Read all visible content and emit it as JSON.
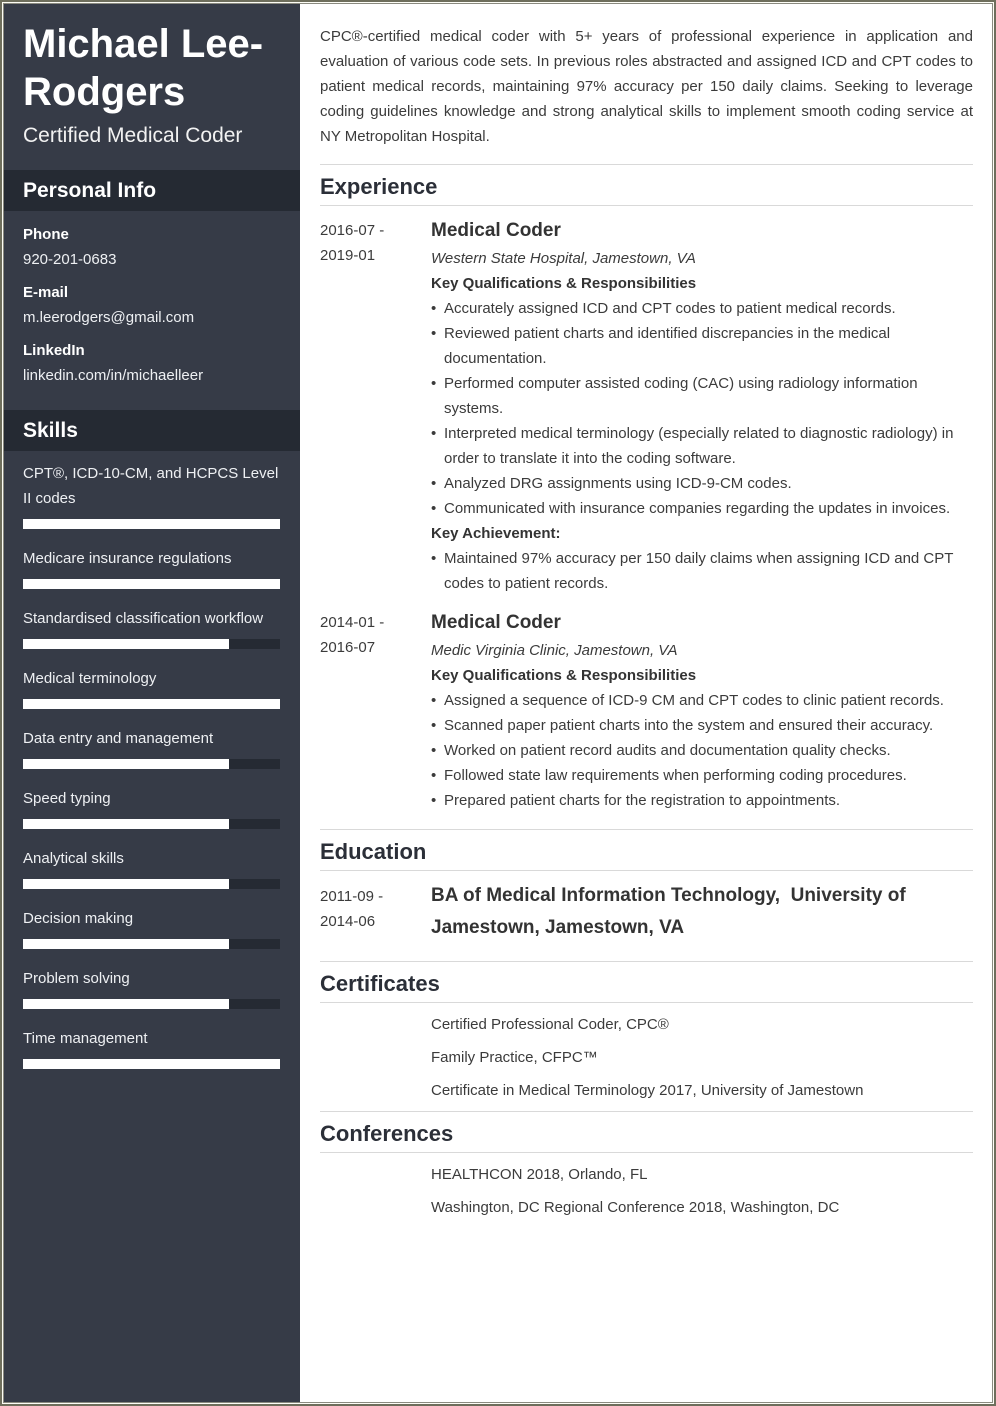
{
  "profile": {
    "name": "Michael Lee-Rodgers",
    "title": "Certified Medical Coder"
  },
  "personal_info": {
    "heading": "Personal Info",
    "fields": [
      {
        "label": "Phone",
        "value": "920-201-0683"
      },
      {
        "label": "E-mail",
        "value": "m.leerodgers@gmail.com"
      },
      {
        "label": "LinkedIn",
        "value": "linkedin.com/in/michaelleer"
      }
    ]
  },
  "skills": {
    "heading": "Skills",
    "items": [
      {
        "name": "CPT®, ICD-10-CM, and HCPCS Level II codes",
        "level": 1.0
      },
      {
        "name": "Medicare insurance regulations",
        "level": 1.0
      },
      {
        "name": "Standardised classification workflow",
        "level": 0.8
      },
      {
        "name": "Medical terminology",
        "level": 1.0
      },
      {
        "name": "Data entry and management",
        "level": 0.8
      },
      {
        "name": "Speed typing",
        "level": 0.8
      },
      {
        "name": "Analytical skills",
        "level": 0.8
      },
      {
        "name": "Decision making",
        "level": 0.8
      },
      {
        "name": "Problem solving",
        "level": 0.8
      },
      {
        "name": "Time management",
        "level": 1.0
      }
    ]
  },
  "summary": "CPC®-certified medical coder with 5+ years of professional experience in application and evaluation of various code sets. In previous roles abstracted and assigned ICD and CPT codes to patient medical records, maintaining 97% accuracy per 150 daily claims. Seeking to leverage coding guidelines knowledge and strong analytical skills to implement smooth coding service at NY Metropolitan Hospital.",
  "experience": {
    "heading": "Experience",
    "jobs": [
      {
        "date_start": "2016-07 -",
        "date_end": "2019-01",
        "title": "Medical Coder",
        "company": "Western State Hospital, Jamestown, VA",
        "resp_heading": "Key Qualifications & Responsibilities",
        "responsibilities": [
          "Accurately assigned ICD and CPT codes to patient medical records.",
          "Reviewed patient charts and identified discrepancies in the medical documentation.",
          "Performed computer assisted coding (CAC) using radiology information systems.",
          "Interpreted medical terminology (especially related to diagnostic radiology) in order to translate it into the coding software.",
          "Analyzed DRG assignments using ICD-9-CM codes.",
          "Communicated with insurance companies regarding the updates in invoices."
        ],
        "achievement_heading": "Key Achievement:",
        "achievements": [
          "Maintained 97% accuracy per 150 daily claims when assigning ICD and CPT codes to patient records."
        ]
      },
      {
        "date_start": "2014-01 -",
        "date_end": "2016-07",
        "title": "Medical Coder",
        "company": "Medic Virginia Clinic, Jamestown, VA",
        "resp_heading": "Key Qualifications & Responsibilities",
        "responsibilities": [
          "Assigned a sequence of ICD-9 CM and CPT codes to clinic patient records.",
          "Scanned paper patient charts into the system and ensured their accuracy.",
          "Worked on patient record audits and documentation quality checks.",
          "Followed state law requirements when performing coding procedures.",
          "Prepared patient charts for the registration to appointments."
        ]
      }
    ]
  },
  "education": {
    "heading": "Education",
    "items": [
      {
        "date_start": "2011-09 -",
        "date_end": "2014-06",
        "degree": "BA of Medical Information Technology,  University of Jamestown, Jamestown, VA"
      }
    ]
  },
  "certificates": {
    "heading": "Certificates",
    "items": [
      "Certified Professional Coder, CPC®",
      "Family Practice, CFPC™",
      "Certificate in Medical Terminology 2017, University of Jamestown"
    ]
  },
  "conferences": {
    "heading": "Conferences",
    "items": [
      "HEALTHCON 2018, Orlando, FL",
      "Washington, DC Regional Conference 2018, Washington, DC"
    ]
  },
  "colors": {
    "sidebar_bg": "#363b47",
    "sidebar_header_bg": "#252a33",
    "bar_fill": "#ffffff",
    "text": "#3b3b3b"
  }
}
